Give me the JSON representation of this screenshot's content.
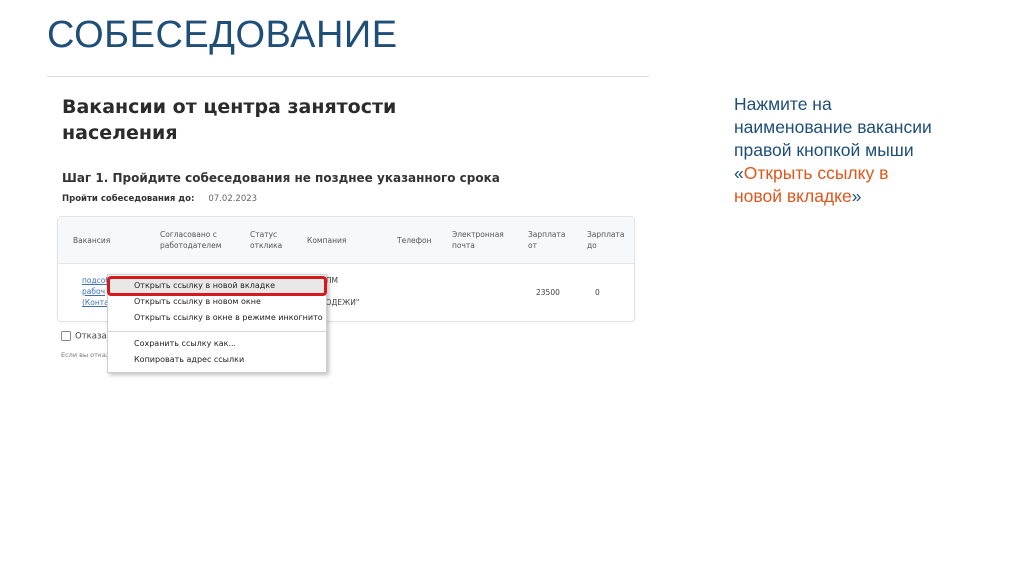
{
  "slide": {
    "title": "СОБЕСЕДОВАНИЕ",
    "instructions": {
      "line1": "Нажмите на",
      "line2": "наименование вакансии",
      "line3": "правой кнопкой мыши",
      "quote_open": "«",
      "action_line1": "Открыть ссылку в",
      "action_line2": "новой вкладке",
      "quote_close": "»"
    }
  },
  "page": {
    "heading": "Вакансии от центра занятости населения",
    "step_title": "Шаг 1. Пройдите собеседования не позднее указанного срока",
    "deadline_label": "Пройти собеседования до:",
    "deadline_value": "07.02.2023",
    "refuse_label": "Отказат",
    "refuse_note": "Если вы откаж"
  },
  "table": {
    "headers": {
      "vacancy": "Вакансия",
      "agreed_1": "Согласовано с",
      "agreed_2": "работодателем",
      "status_1": "Статус",
      "status_2": "отклика",
      "company": "Компания",
      "phone": "Телефон",
      "email_1": "Электронная",
      "email_2": "почта",
      "salary_from_1": "Зарплата",
      "salary_from_2": "от",
      "salary_to_1": "Зарплата",
      "salary_to_2": "до"
    },
    "row": {
      "vacancy_1": "подсоб",
      "vacancy_2": "рабоч",
      "vacancy_3": "(Контак",
      "company_1": "ОПМ",
      "company_2": "Р",
      "company_3": "ЛОДЕЖИ\"",
      "salary_from": "23500",
      "salary_to": "0"
    }
  },
  "context_menu": {
    "items": [
      "Открыть ссылку в новой вкладке",
      "Открыть ссылку в новом окне",
      "Открыть ссылку в окне в режиме инкогнито",
      "Сохранить ссылку как...",
      "Копировать адрес ссылки"
    ],
    "highlight_color": "#d7191c"
  },
  "colors": {
    "title_blue": "#1f4e79",
    "accent_orange": "#e0561b"
  }
}
